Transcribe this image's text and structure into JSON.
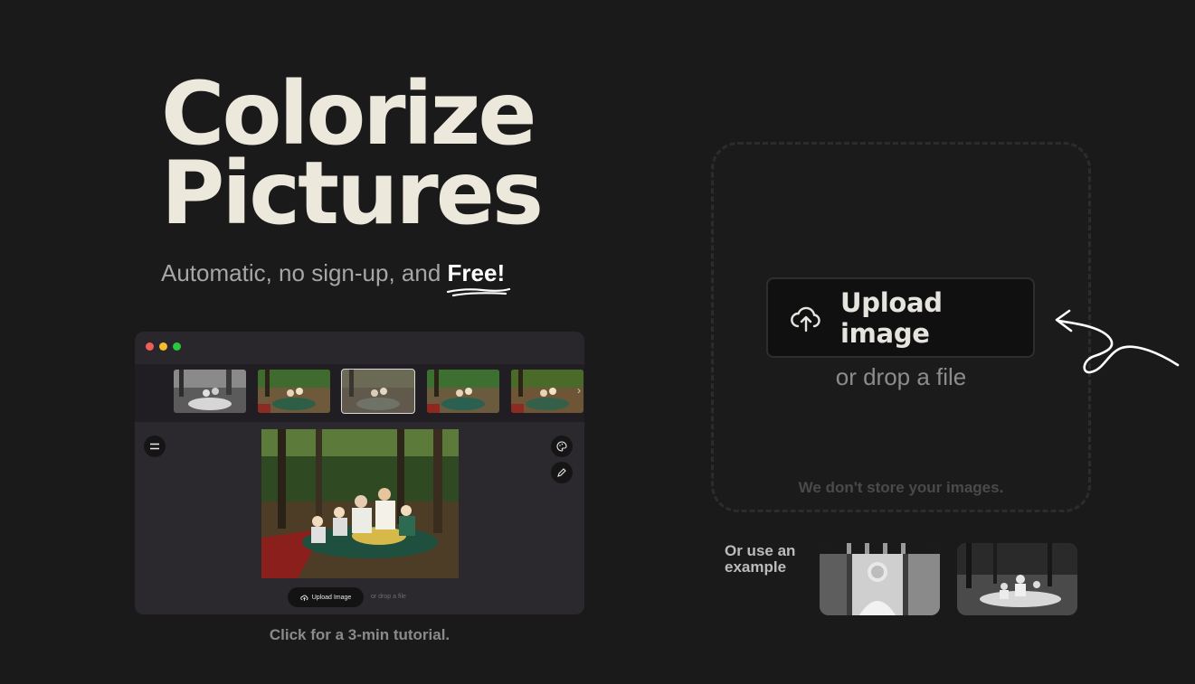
{
  "hero": {
    "title_line1": "Colorize",
    "title_line2": "Pictures",
    "subtitle_prefix": "Automatic, no sign-up, and ",
    "subtitle_emphasis": "Free!"
  },
  "tutorial": {
    "mini_upload_label": "Upload Image",
    "mini_drop_hint": "or drop a file",
    "caption": "Click for a 3-min tutorial."
  },
  "upload": {
    "button_label": "Upload image",
    "drop_hint": "or drop a file",
    "privacy_note": "We don't store your images."
  },
  "examples": {
    "label": "Or use an example"
  },
  "colors": {
    "background": "#1b1a1b",
    "title": "#ece8dc",
    "button_bg": "#111011"
  }
}
